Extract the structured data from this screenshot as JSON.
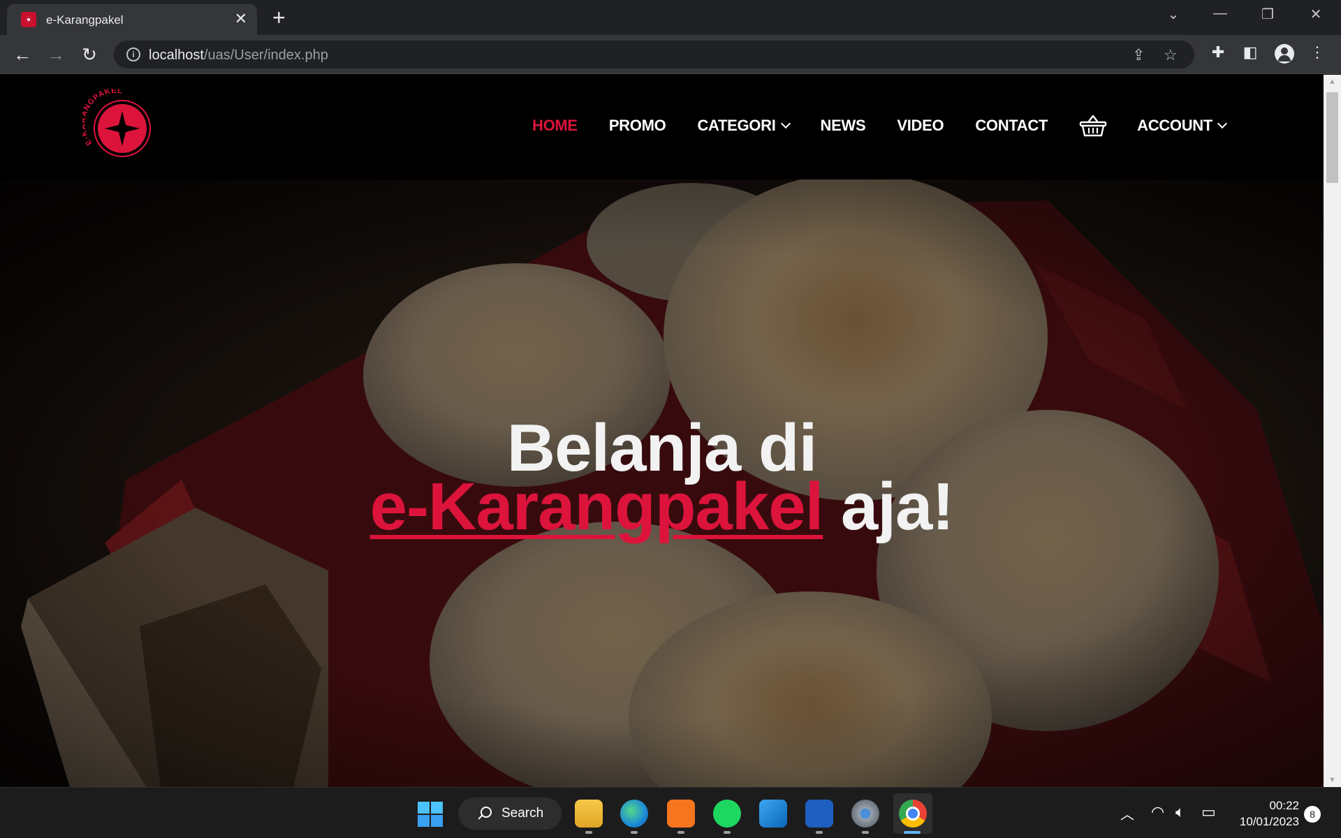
{
  "browser": {
    "tab_title": "e-Karangpakel",
    "tab_close": "✕",
    "new_tab": "+",
    "url_host": "localhost",
    "url_path": "/uas/User/index.php",
    "window_controls": [
      "⌄",
      "—",
      "❐",
      "✕"
    ]
  },
  "site": {
    "logo_text": "E-KARANGPAKEL",
    "nav": [
      {
        "label": "HOME",
        "active": true
      },
      {
        "label": "PROMO"
      },
      {
        "label": "CATEGORI",
        "dropdown": true
      },
      {
        "label": "NEWS"
      },
      {
        "label": "VIDEO"
      },
      {
        "label": "CONTACT"
      },
      {
        "label": "ACCOUNT",
        "dropdown": true
      }
    ],
    "cart_icon": "basket-icon"
  },
  "hero": {
    "line1": "Belanja di",
    "brand": "e-Karangpakel",
    "line2_suffix": " aja!"
  },
  "taskbar": {
    "search_label": "Search",
    "time": "00:22",
    "date": "10/01/2023",
    "notifications": "8"
  },
  "colors": {
    "accent": "#dc143c",
    "header_bg": "#000000",
    "chrome_bg": "#35363a"
  }
}
